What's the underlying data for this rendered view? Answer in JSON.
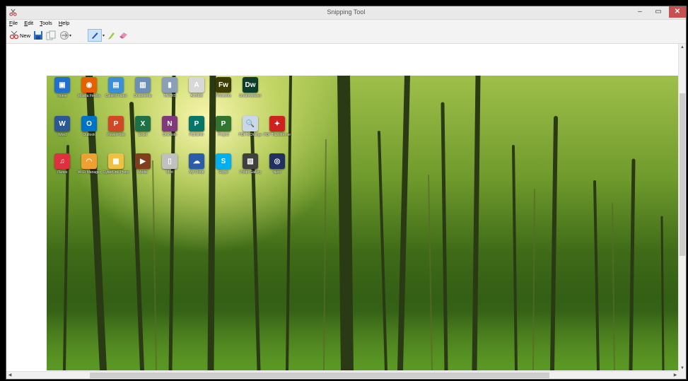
{
  "window": {
    "title": "Snipping Tool",
    "controls": {
      "minimize": "–",
      "maximize": "▭",
      "close": "✕"
    }
  },
  "menu": [
    "File",
    "Edit",
    "Tools",
    "Help"
  ],
  "toolbar": {
    "new_label": "New",
    "dropdown_arrow": "▾"
  },
  "colors": {
    "close": "#c75050",
    "selected_tool": "#cde3f7"
  },
  "desktop_icons": [
    {
      "label": "Home",
      "icon": "computer-icon",
      "color": "#1f6fd1",
      "glyph": "▣"
    },
    {
      "label": "Mozilla Firefox",
      "icon": "firefox-icon",
      "color": "#e66000",
      "glyph": "◉"
    },
    {
      "label": "Control Panel",
      "icon": "control-panel-icon",
      "color": "#3a8fd8",
      "glyph": "▤"
    },
    {
      "label": "Documents",
      "icon": "documents-icon",
      "color": "#6b8fb8",
      "glyph": "▥"
    },
    {
      "label": "TARDIS",
      "icon": "tardis-icon",
      "color": "#8aa0b8",
      "glyph": "▮"
    },
    {
      "label": "Acrobat",
      "icon": "acrobat-icon",
      "color": "#d8d8d8",
      "glyph": "A"
    },
    {
      "label": "Fireworks",
      "icon": "fireworks-icon",
      "color": "#3d3d00",
      "glyph": "Fw"
    },
    {
      "label": "Dreamweaver",
      "icon": "dreamweaver-icon",
      "color": "#0a3d2a",
      "glyph": "Dw"
    },
    {
      "label": "Word",
      "icon": "word-icon",
      "color": "#2b5797",
      "glyph": "W"
    },
    {
      "label": "Outlook",
      "icon": "outlook-icon",
      "color": "#0072c6",
      "glyph": "O"
    },
    {
      "label": "PowerPoint",
      "icon": "powerpoint-icon",
      "color": "#d24726",
      "glyph": "P"
    },
    {
      "label": "Excel",
      "icon": "excel-icon",
      "color": "#1e7145",
      "glyph": "X"
    },
    {
      "label": "OneNote",
      "icon": "onenote-icon",
      "color": "#80397b",
      "glyph": "N"
    },
    {
      "label": "Publisher",
      "icon": "publisher-icon",
      "color": "#077568",
      "glyph": "P"
    },
    {
      "label": "Project",
      "icon": "project-icon",
      "color": "#31752f",
      "glyph": "P"
    },
    {
      "label": "PDF-XChange",
      "icon": "pdf-viewer-icon",
      "color": "#c8d8e8",
      "glyph": "🔍"
    },
    {
      "label": "PDF Transformer",
      "icon": "pdf-transformer-icon",
      "color": "#d02020",
      "glyph": "✦"
    },
    {
      "label": "iTunes",
      "icon": "itunes-icon",
      "color": "#e03040",
      "glyph": "♫"
    },
    {
      "label": "Wi-Fi Manager",
      "icon": "wifi-icon",
      "color": "#f0a030",
      "glyph": "◠"
    },
    {
      "label": "CyberLink Photo",
      "icon": "photo-icon",
      "color": "#f0c040",
      "glyph": "▦"
    },
    {
      "label": "Media",
      "icon": "media-icon",
      "color": "#804020",
      "glyph": "▶"
    },
    {
      "label": "Mint",
      "icon": "mint-icon",
      "color": "#c0c0c0",
      "glyph": "▯"
    },
    {
      "label": "My Cloud",
      "icon": "cloud-icon",
      "color": "#2a5caa",
      "glyph": "☁"
    },
    {
      "label": "Skype",
      "icon": "skype-icon",
      "color": "#00aff0",
      "glyph": "S"
    },
    {
      "label": "Photo Gallery",
      "icon": "gallery-icon",
      "color": "#404040",
      "glyph": "▧"
    },
    {
      "label": "Nero",
      "icon": "disc-icon",
      "color": "#203060",
      "glyph": "◎"
    }
  ]
}
